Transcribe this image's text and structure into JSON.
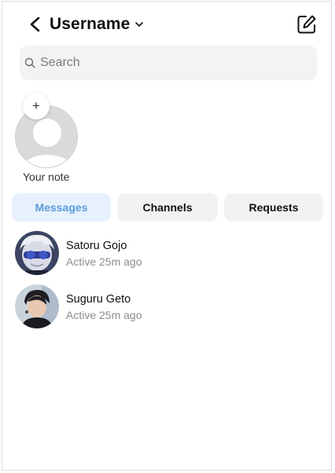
{
  "header": {
    "username": "Username",
    "back_icon": "chevron-left-icon",
    "dropdown_icon": "chevron-down-icon",
    "compose_icon": "compose-icon"
  },
  "search": {
    "placeholder": "Search",
    "value": "",
    "icon": "search-icon"
  },
  "note": {
    "add_symbol": "+",
    "label": "Your note"
  },
  "tabs": [
    {
      "label": "Messages",
      "active": true
    },
    {
      "label": "Channels",
      "active": false
    },
    {
      "label": "Requests",
      "active": false
    }
  ],
  "conversations": [
    {
      "name": "Satoru Gojo",
      "status": "Active 25m ago"
    },
    {
      "name": "Suguru Geto",
      "status": "Active 25m ago"
    }
  ],
  "colors": {
    "active_tab_bg": "#e6f1fd",
    "active_tab_text": "#5c9bd9",
    "inactive_tab_bg": "#f1f2f4",
    "search_bg": "#f2f3f5",
    "muted_text": "#8a8d91"
  }
}
